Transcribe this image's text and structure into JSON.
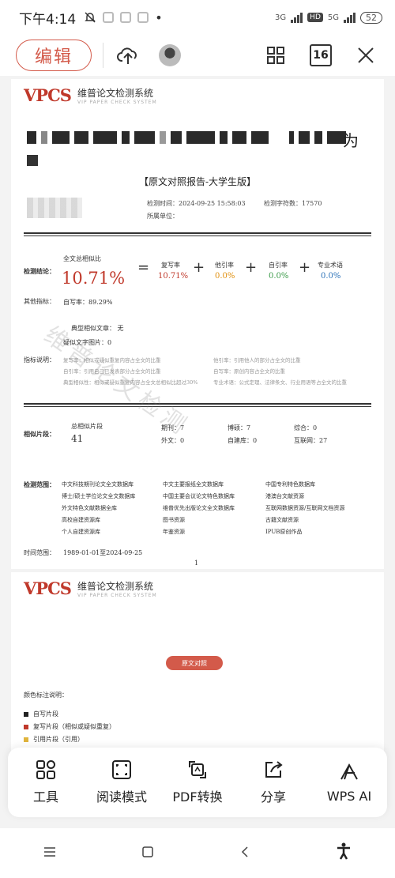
{
  "status_bar": {
    "time": "下午4:14",
    "network_3g": "3G",
    "hd": "HD",
    "network_5g": "5G",
    "battery": "52"
  },
  "toolbar": {
    "edit_label": "编辑",
    "page_count": "16"
  },
  "page1": {
    "logo_mark": "VPCS",
    "logo_cn": "维普论文检测系统",
    "logo_en": "VIP PAPER CHECK SYSTEM",
    "title_tail": "为",
    "report_type": "【原文对照报告-大学生版】",
    "detect_time": "检测时间：2024-09-25 15:58:03",
    "char_count": "检测字符数：17570",
    "unit": "所属单位：",
    "conclusion_label": "检测结论：",
    "total_label": "全文总相似比",
    "total_value": "10.71%",
    "copy_label": "复写率",
    "copy_value": "10.71%",
    "other_label": "他引率",
    "other_value": "0.0%",
    "self_label": "自引率",
    "self_value": "0.0%",
    "term_label": "专业术语",
    "term_value": "0.0%",
    "other_index_label": "其他指标：",
    "self_write": "自写率：89.29%",
    "typical_article": "典型相似文章：  无",
    "suspect_images": "疑似文字图片：0",
    "desc_label": "指标说明：",
    "desc_lines": [
      "复写率：相似或疑似重复内容占全文的比重",
      "他引率：引用他人的部分占全文的比重",
      "自引率：引用自己已发表部分占全文的比重",
      "自写率：原创内容占全文的比重",
      "典型相似性：相似或疑似重复内容占全文总相似比超过30%",
      "专业术语：公式定理、法律条文、行业用语等占全文的比重"
    ],
    "seg_label": "相似片段：",
    "seg_total_label": "总相似片段",
    "seg_total_value": "41",
    "seg_items": [
      "期刊：7",
      "博硕：7",
      "综合：0",
      "外文：0",
      "自建库：0",
      "互联网：27"
    ],
    "scope_label": "检测范围：",
    "scope_items": [
      "中文科技期刊论文全文数据库",
      "中文主要报纸全文数据库",
      "中国专利特色数据库",
      "博士/硕士学位论文全文数据库",
      "中国主要会议论文特色数据库",
      "港澳台文献资源",
      "外文特色文献数据全库",
      "维普优先出版论文全文数据库",
      "互联网数据资源/互联网文档资源",
      "高校自建资源库",
      "图书资源",
      "古籍文献资源",
      "个人自建资源库",
      "年鉴资源",
      "IPUB原创作品"
    ],
    "time_range_label": "时间范围：",
    "time_range_value": "1989-01-01至2024-09-25",
    "page_number": "1",
    "watermark": "维普论文检测"
  },
  "page2": {
    "logo_mark": "VPCS",
    "logo_cn": "维普论文检测系统",
    "logo_en": "VIP PAPER CHECK SYSTEM",
    "pill_label": "原文对照",
    "legend_title": "颜色标注说明：",
    "legend": [
      {
        "label": "自写片段",
        "color": "#222222"
      },
      {
        "label": "复写片段（相似或疑似重复）",
        "color": "#c0392b"
      },
      {
        "label": "引用片段（引用）",
        "color": "#e0b43c"
      }
    ]
  },
  "actions": [
    {
      "label": "工具",
      "icon": "tools-grid-icon"
    },
    {
      "label": "阅读模式",
      "icon": "expand-icon"
    },
    {
      "label": "PDF转换",
      "icon": "pdf-convert-icon"
    },
    {
      "label": "分享",
      "icon": "share-icon"
    },
    {
      "label": "WPS AI",
      "icon": "wps-ai-icon"
    }
  ],
  "accent_color": "#d35a4a"
}
